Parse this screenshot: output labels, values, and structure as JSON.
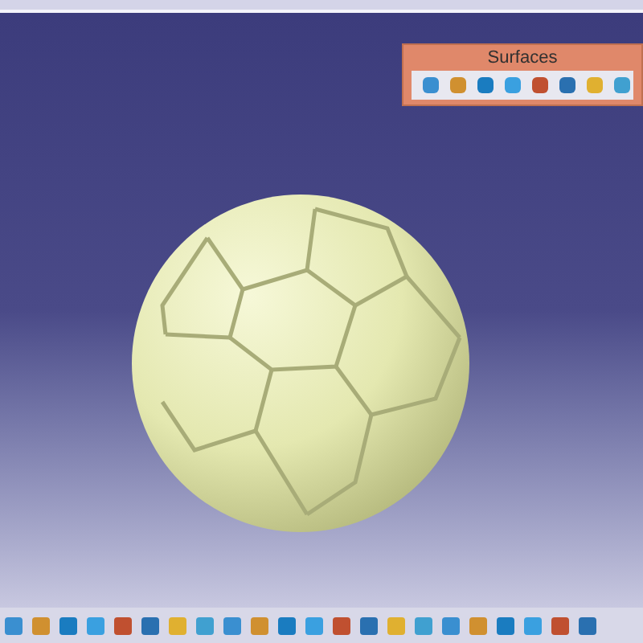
{
  "toolbar_panel": {
    "title": "Surfaces"
  }
}
